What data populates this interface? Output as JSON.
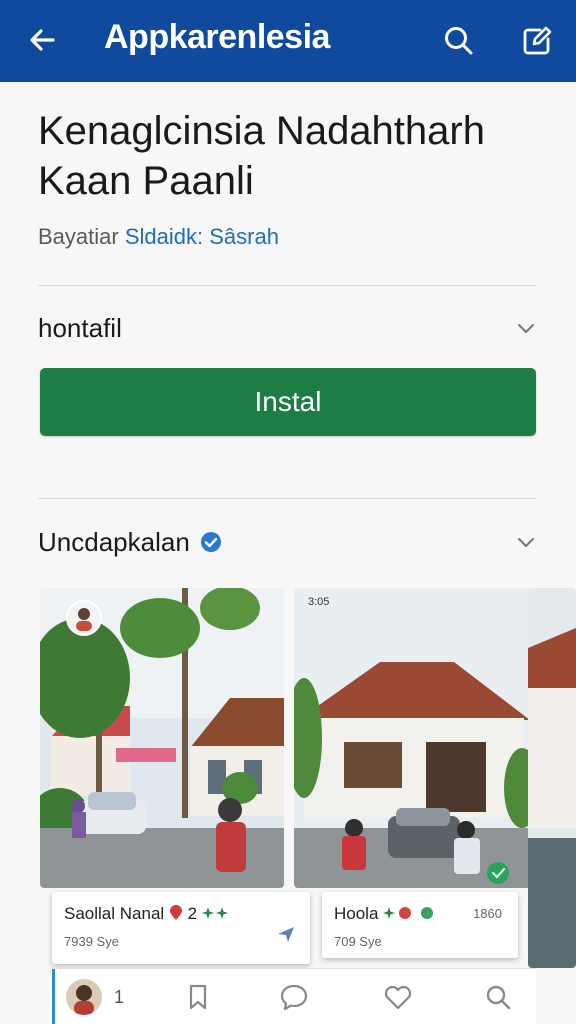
{
  "appbar": {
    "title": "Appkarenlesia",
    "bg_color": "#0f4a9e",
    "back_icon": "arrow-left-icon",
    "search_icon": "search-icon",
    "edit_icon": "edit-icon"
  },
  "app": {
    "title": "Kenaglcinsia Nadahtharh Kaan Paanli",
    "developer_prefix": "Bayatiar",
    "developer_link": "Sldaidk: Sâsrah"
  },
  "sections": {
    "info_label": "hontafil",
    "install_label": "Instal",
    "install_color": "#1e7d45",
    "screenshots_label": "Uncdapkalan"
  },
  "screenshots": {
    "status_time": "3:05",
    "card1": {
      "title": "Saollal Nanal",
      "tags": "2",
      "subtitle": "7939 Sye"
    },
    "card2": {
      "title": "Hoola",
      "count": "1860",
      "subtitle": "709 Sye"
    }
  },
  "bottom_bar": {
    "count": "1",
    "accent_color": "#2a8ed8",
    "icons": [
      "bookmark-icon",
      "comment-icon",
      "heart-icon",
      "search-icon"
    ]
  }
}
